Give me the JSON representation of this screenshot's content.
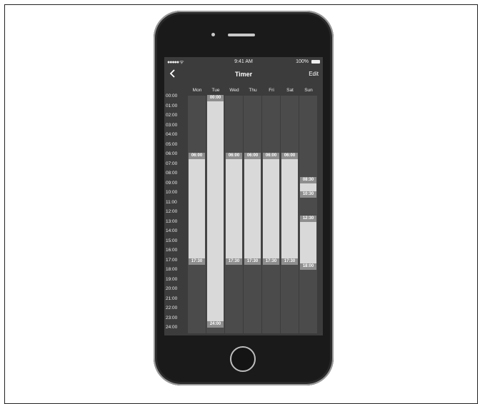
{
  "status_bar": {
    "signal": "●●●●● ᯤ",
    "time": "9:41 AM",
    "battery": "100%"
  },
  "nav": {
    "back_icon": "chevron-left-icon",
    "title": "Timer",
    "edit_label": "Edit"
  },
  "days": [
    "Mon",
    "Tue",
    "Wed",
    "Thu",
    "Fri",
    "Sat",
    "Sun"
  ],
  "hours": [
    "00:00",
    "01:00",
    "02:00",
    "03:00",
    "04:00",
    "05:00",
    "06:00",
    "07:00",
    "08:00",
    "09:00",
    "10:00",
    "11:00",
    "12:00",
    "13:00",
    "14:00",
    "15:00",
    "16:00",
    "17:00",
    "18:00",
    "19:00",
    "20:00",
    "21:00",
    "22:00",
    "23:00",
    "24:00"
  ],
  "schedule": [
    {
      "day": "Mon",
      "blocks": [
        {
          "start": "06:00",
          "end": "17:30"
        }
      ]
    },
    {
      "day": "Tue",
      "blocks": [
        {
          "start": "00:00",
          "end": "24:00"
        }
      ]
    },
    {
      "day": "Wed",
      "blocks": [
        {
          "start": "06:00",
          "end": "17:30"
        }
      ]
    },
    {
      "day": "Thu",
      "blocks": [
        {
          "start": "06:00",
          "end": "17:30"
        }
      ]
    },
    {
      "day": "Fri",
      "blocks": [
        {
          "start": "06:00",
          "end": "17:30"
        }
      ]
    },
    {
      "day": "Sat",
      "blocks": [
        {
          "start": "06:00",
          "end": "17:30"
        }
      ]
    },
    {
      "day": "Sun",
      "blocks": [
        {
          "start": "08:30",
          "end": "10:30"
        },
        {
          "start": "12:30",
          "end": "18:00"
        }
      ]
    }
  ]
}
